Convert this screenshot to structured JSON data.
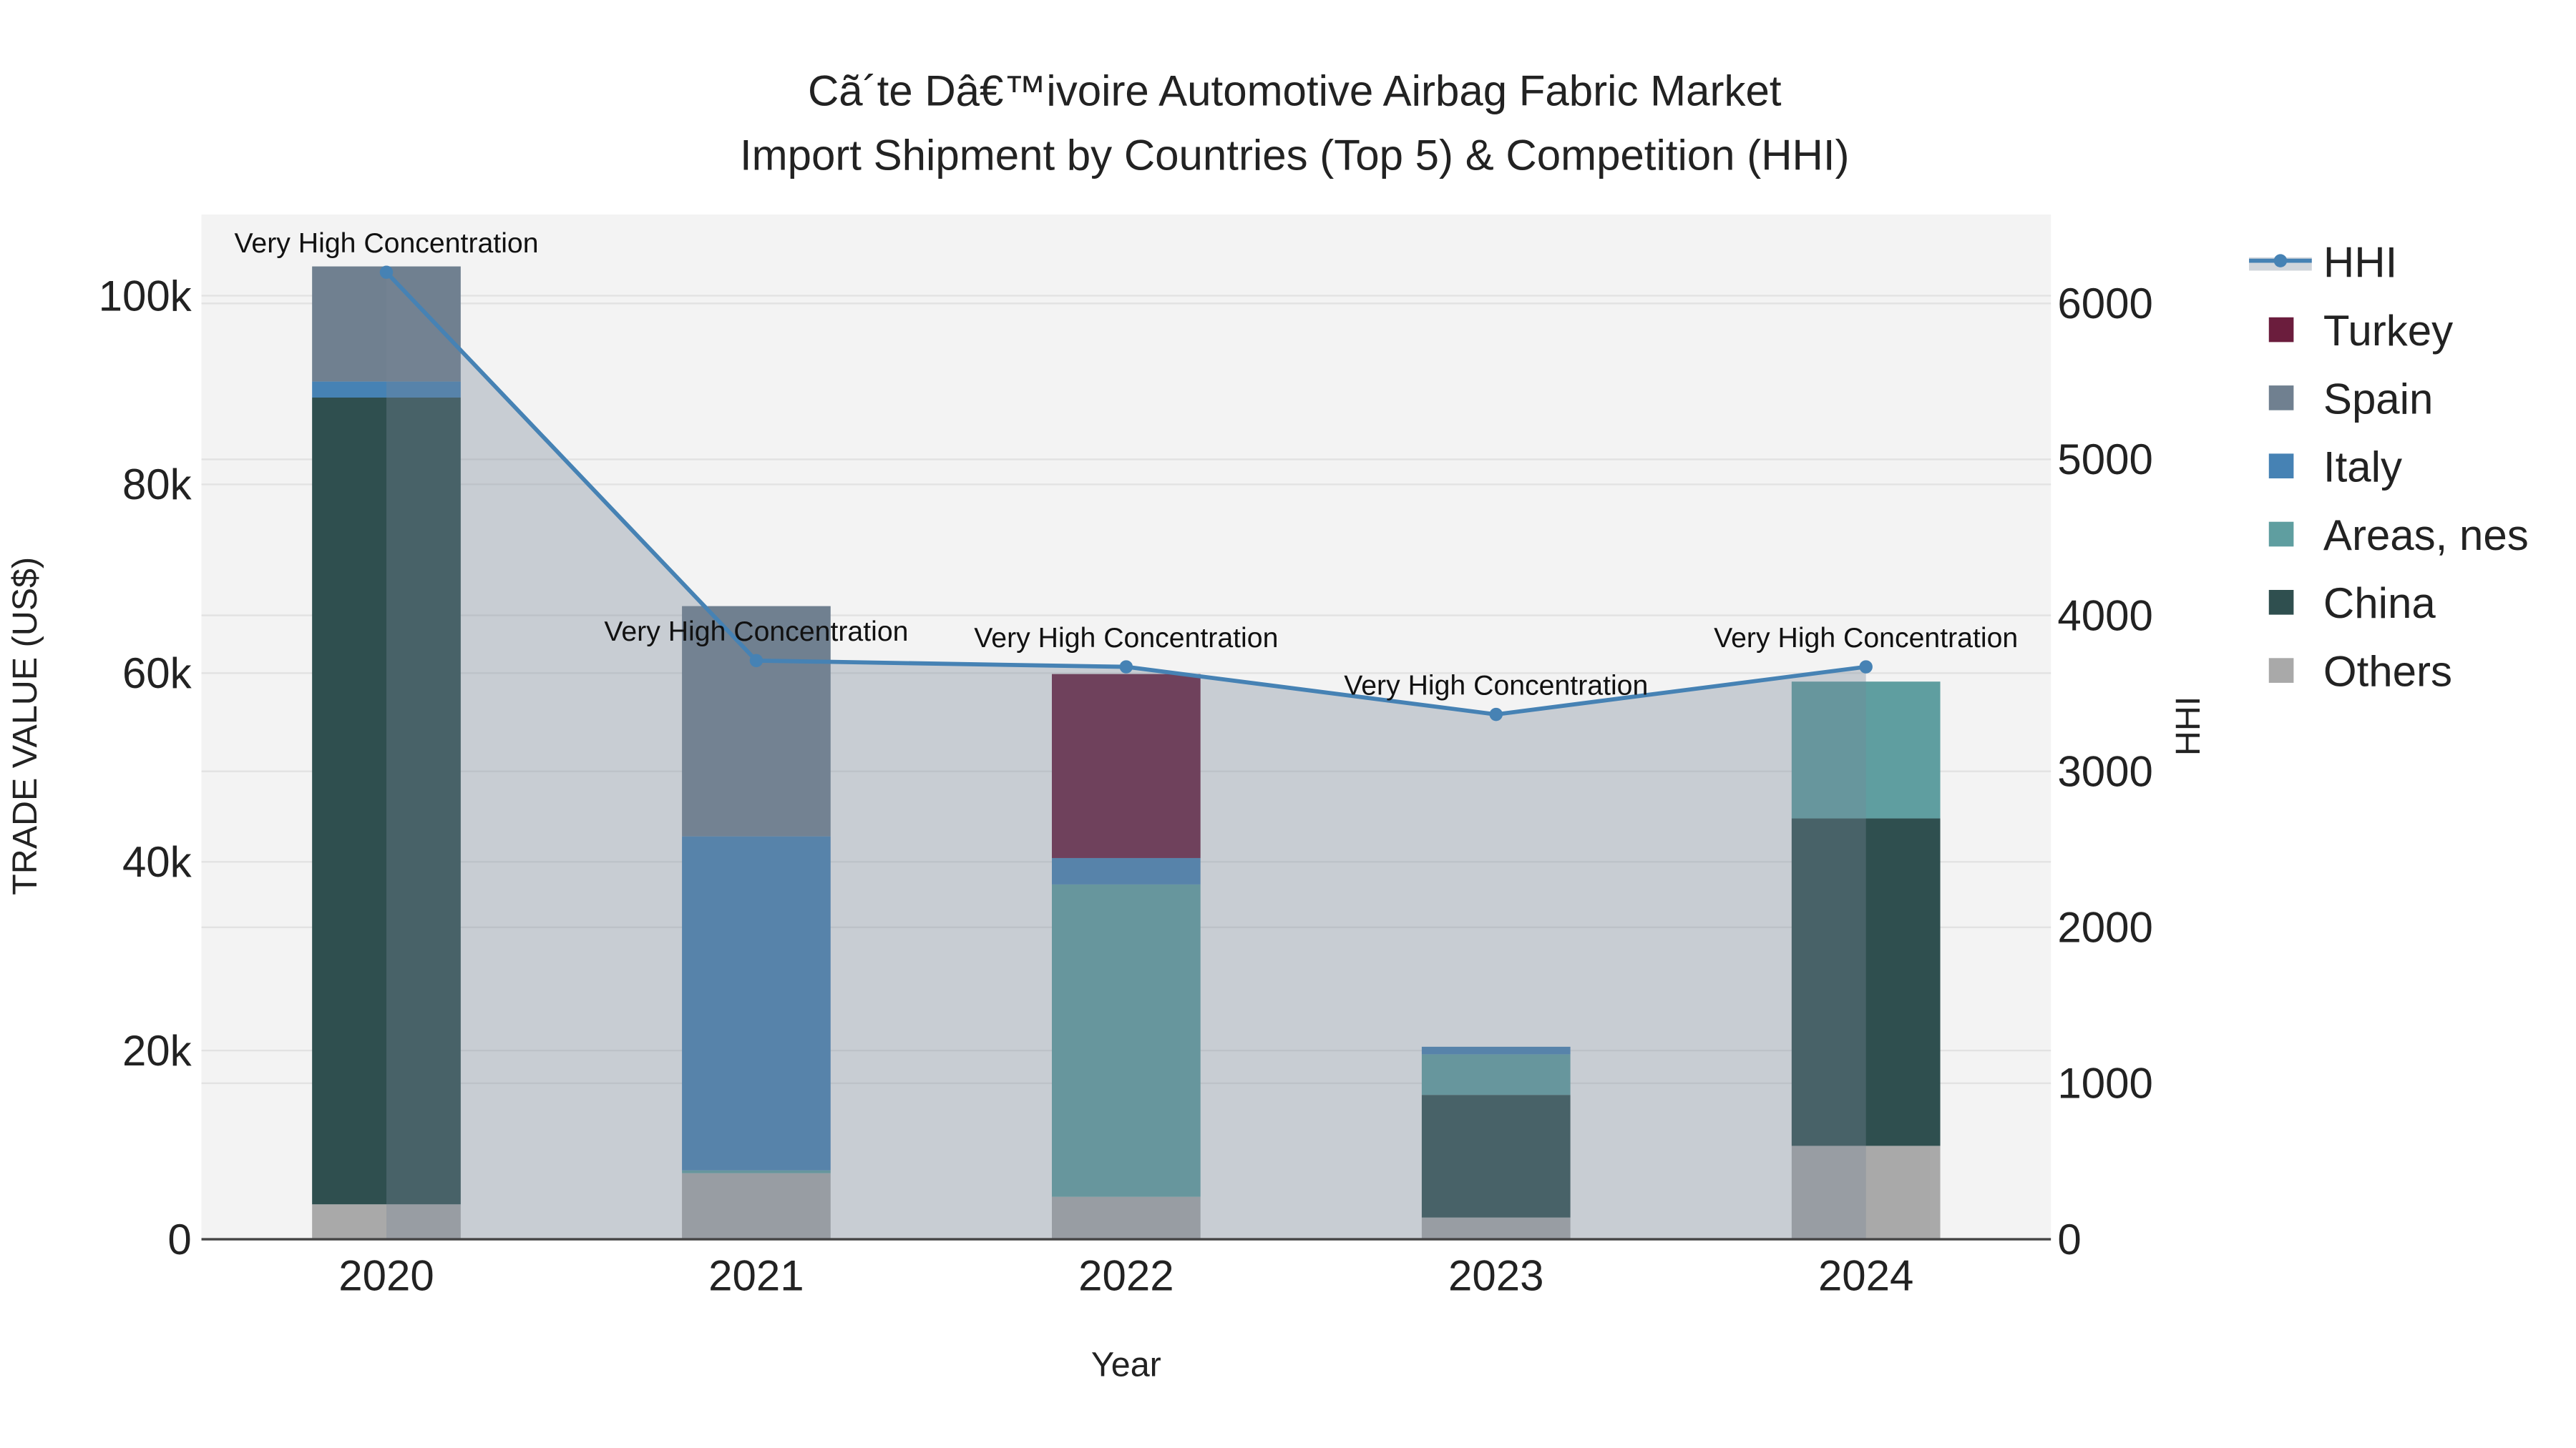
{
  "chart_data": {
    "type": "bar",
    "title_line1": "Cã´te Dâ€™ivoire Automotive Airbag Fabric Market",
    "title_line2": "Import Shipment by Countries (Top 5) & Competition (HHI)",
    "xlabel": "Year",
    "ylabel": "TRADE VALUE (US$)",
    "y2label": "HHI",
    "categories": [
      "2020",
      "2021",
      "2022",
      "2023",
      "2024"
    ],
    "ylim": [
      0,
      108600
    ],
    "y2lim": [
      0,
      6570
    ],
    "yticks": [
      0,
      20000,
      40000,
      60000,
      80000,
      100000
    ],
    "ytick_labels": [
      "0",
      "20k",
      "40k",
      "60k",
      "80k",
      "100k"
    ],
    "y2ticks": [
      0,
      1000,
      2000,
      3000,
      4000,
      5000,
      6000
    ],
    "y2tick_labels": [
      "0",
      "1000",
      "2000",
      "3000",
      "4000",
      "5000",
      "6000"
    ],
    "grid": true,
    "legend_position": "right",
    "series": [
      {
        "name": "Others",
        "color": "#a9a9a9",
        "values": [
          3700,
          7000,
          4500,
          2300,
          9900
        ]
      },
      {
        "name": "China",
        "color": "#2f4f4f",
        "values": [
          85500,
          0,
          0,
          13000,
          34700
        ]
      },
      {
        "name": "Areas, nes",
        "color": "#5f9ea0",
        "values": [
          0,
          300,
          33100,
          4300,
          14500
        ]
      },
      {
        "name": "Italy",
        "color": "#4682b4",
        "values": [
          1700,
          35400,
          2800,
          800,
          0
        ]
      },
      {
        "name": "Spain",
        "color": "#708090",
        "values": [
          12200,
          24400,
          0,
          0,
          0
        ]
      },
      {
        "name": "Turkey",
        "color": "#6b1d3d",
        "values": [
          0,
          0,
          19500,
          0,
          0
        ]
      }
    ],
    "hhi": {
      "name": "HHI",
      "color": "#4682b4",
      "values": [
        6200,
        3710,
        3670,
        3365,
        3670
      ],
      "annotations": [
        "Very High Concentration",
        "Very High Concentration",
        "Very High Concentration",
        "Very High Concentration",
        "Very High Concentration"
      ]
    },
    "legend_order": [
      "HHI",
      "Turkey",
      "Spain",
      "Italy",
      "Areas, nes",
      "China",
      "Others"
    ]
  }
}
